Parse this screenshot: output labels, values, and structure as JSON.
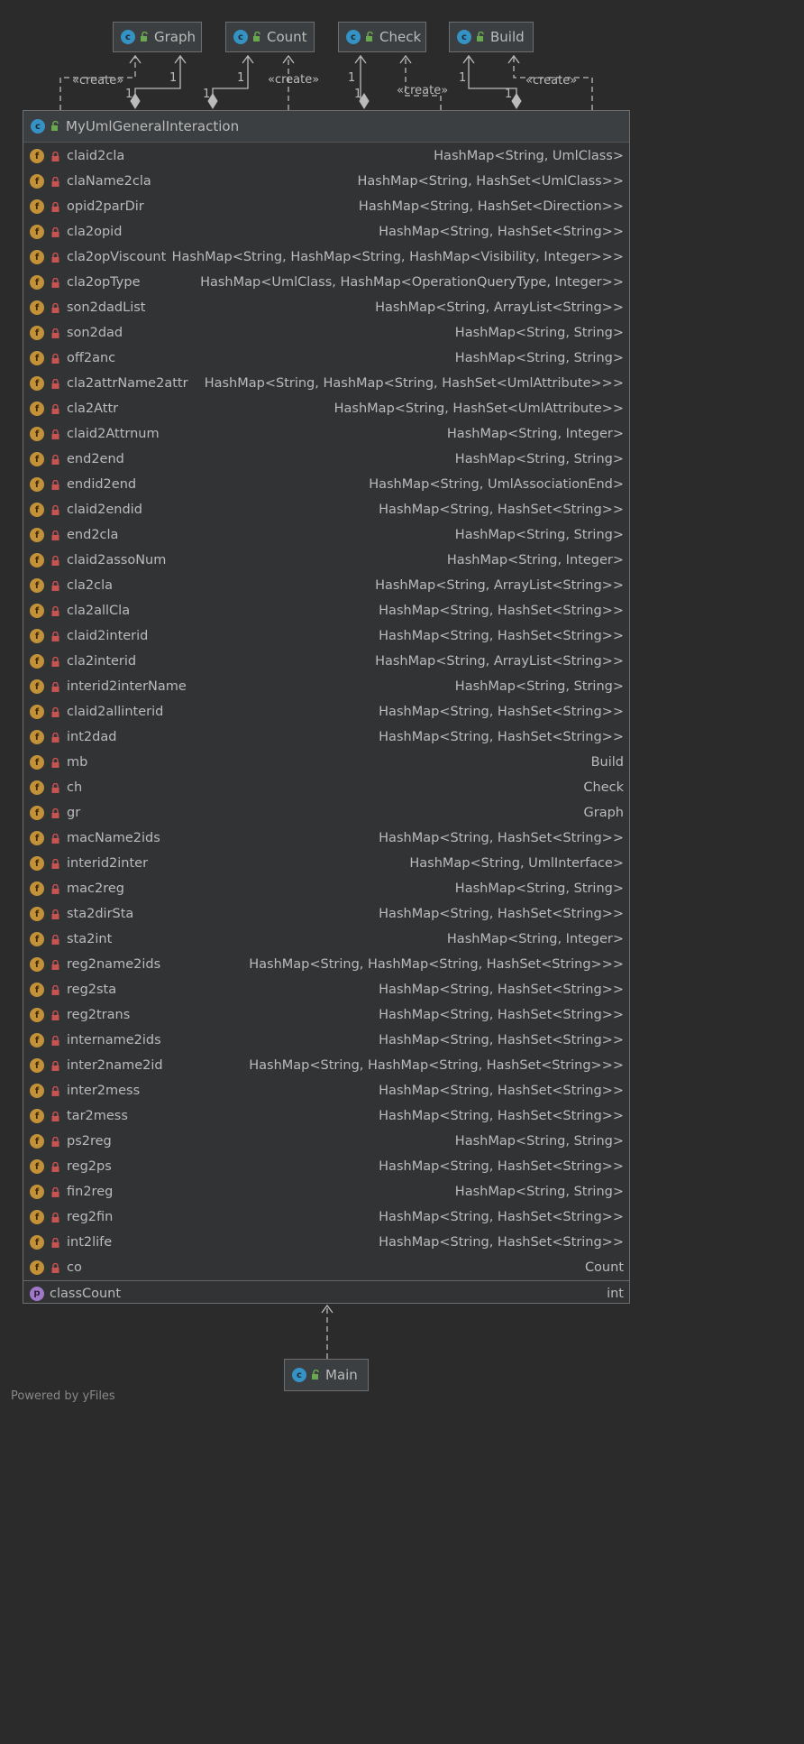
{
  "top_classes": [
    {
      "name": "Graph"
    },
    {
      "name": "Count"
    },
    {
      "name": "Check"
    },
    {
      "name": "Build"
    }
  ],
  "class_icon_letter": "c",
  "field_icon_letter": "f",
  "property_icon_letter": "p",
  "edge_labels": {
    "create": "«create»",
    "one": "1"
  },
  "main_class": {
    "name": "MyUmlGeneralInteraction",
    "fields": [
      {
        "name": "claid2cla",
        "type": "HashMap<String, UmlClass>"
      },
      {
        "name": "claName2cla",
        "type": "HashMap<String, HashSet<UmlClass>>"
      },
      {
        "name": "opid2parDir",
        "type": "HashMap<String, HashSet<Direction>>"
      },
      {
        "name": "cla2opid",
        "type": "HashMap<String, HashSet<String>>"
      },
      {
        "name": "cla2opViscount",
        "type": "HashMap<String, HashMap<String, HashMap<Visibility, Integer>>>"
      },
      {
        "name": "cla2opType",
        "type": "HashMap<UmlClass, HashMap<OperationQueryType, Integer>>"
      },
      {
        "name": "son2dadList",
        "type": "HashMap<String, ArrayList<String>>"
      },
      {
        "name": "son2dad",
        "type": "HashMap<String, String>"
      },
      {
        "name": "off2anc",
        "type": "HashMap<String, String>"
      },
      {
        "name": "cla2attrName2attr",
        "type": "HashMap<String, HashMap<String, HashSet<UmlAttribute>>>"
      },
      {
        "name": "cla2Attr",
        "type": "HashMap<String, HashSet<UmlAttribute>>"
      },
      {
        "name": "claid2Attrnum",
        "type": "HashMap<String, Integer>"
      },
      {
        "name": "end2end",
        "type": "HashMap<String, String>"
      },
      {
        "name": "endid2end",
        "type": "HashMap<String, UmlAssociationEnd>"
      },
      {
        "name": "claid2endid",
        "type": "HashMap<String, HashSet<String>>"
      },
      {
        "name": "end2cla",
        "type": "HashMap<String, String>"
      },
      {
        "name": "claid2assoNum",
        "type": "HashMap<String, Integer>"
      },
      {
        "name": "cla2cla",
        "type": "HashMap<String, ArrayList<String>>"
      },
      {
        "name": "cla2allCla",
        "type": "HashMap<String, HashSet<String>>"
      },
      {
        "name": "claid2interid",
        "type": "HashMap<String, HashSet<String>>"
      },
      {
        "name": "cla2interid",
        "type": "HashMap<String, ArrayList<String>>"
      },
      {
        "name": "interid2interName",
        "type": "HashMap<String, String>"
      },
      {
        "name": "claid2allinterid",
        "type": "HashMap<String, HashSet<String>>"
      },
      {
        "name": "int2dad",
        "type": "HashMap<String, HashSet<String>>"
      },
      {
        "name": "mb",
        "type": "Build"
      },
      {
        "name": "ch",
        "type": "Check"
      },
      {
        "name": "gr",
        "type": "Graph"
      },
      {
        "name": "macName2ids",
        "type": "HashMap<String, HashSet<String>>"
      },
      {
        "name": "interid2inter",
        "type": "HashMap<String, UmlInterface>"
      },
      {
        "name": "mac2reg",
        "type": "HashMap<String, String>"
      },
      {
        "name": "sta2dirSta",
        "type": "HashMap<String, HashSet<String>>"
      },
      {
        "name": "sta2int",
        "type": "HashMap<String, Integer>"
      },
      {
        "name": "reg2name2ids",
        "type": "HashMap<String, HashMap<String, HashSet<String>>>"
      },
      {
        "name": "reg2sta",
        "type": "HashMap<String, HashSet<String>>"
      },
      {
        "name": "reg2trans",
        "type": "HashMap<String, HashSet<String>>"
      },
      {
        "name": "intername2ids",
        "type": "HashMap<String, HashSet<String>>"
      },
      {
        "name": "inter2name2id",
        "type": "HashMap<String, HashMap<String, HashSet<String>>>"
      },
      {
        "name": "inter2mess",
        "type": "HashMap<String, HashSet<String>>"
      },
      {
        "name": "tar2mess",
        "type": "HashMap<String, HashSet<String>>"
      },
      {
        "name": "ps2reg",
        "type": "HashMap<String, String>"
      },
      {
        "name": "reg2ps",
        "type": "HashMap<String, HashSet<String>>"
      },
      {
        "name": "fin2reg",
        "type": "HashMap<String, String>"
      },
      {
        "name": "reg2fin",
        "type": "HashMap<String, HashSet<String>>"
      },
      {
        "name": "int2life",
        "type": "HashMap<String, HashSet<String>>"
      },
      {
        "name": "co",
        "type": "Count"
      }
    ],
    "properties": [
      {
        "name": "classCount",
        "type": "int"
      }
    ]
  },
  "bottom_class": {
    "name": "Main"
  },
  "footer": "Powered by yFiles",
  "colors": {
    "background": "#2b2b2b",
    "box": "#3c3f41",
    "border": "#6e6e6e",
    "text": "#bbbbbb",
    "class_icon": "#3592c4",
    "field_icon": "#c39138",
    "lock": "#c75450",
    "open_lock": "#6aa84f",
    "property_icon": "#9f78c7",
    "edge": "#bbbbbb"
  }
}
